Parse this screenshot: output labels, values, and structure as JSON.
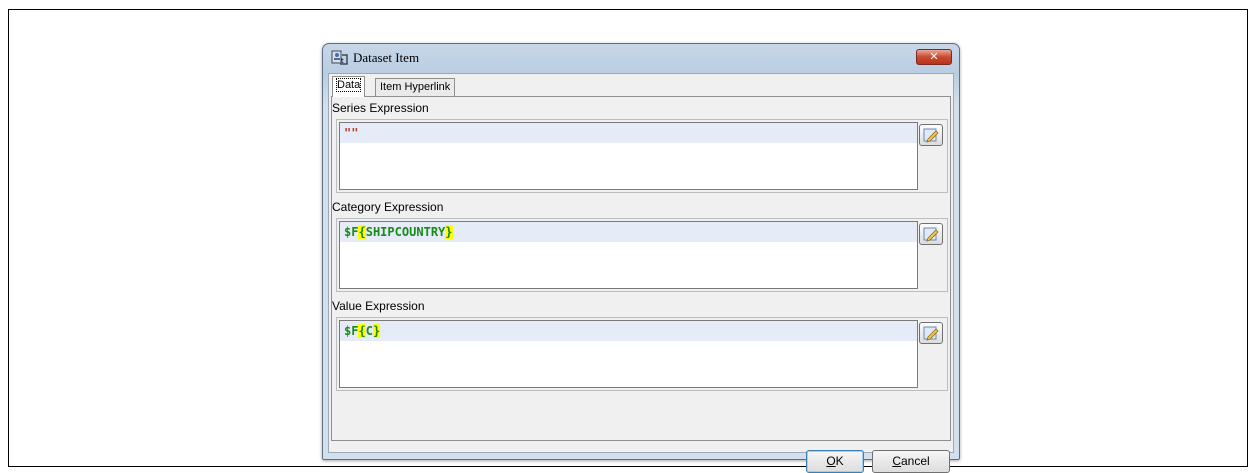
{
  "dialog": {
    "title": "Dataset Item",
    "close_label": "✕",
    "icons": {
      "app": "dataset-item-icon",
      "close": "close-icon",
      "editor": "edit-expression-icon"
    }
  },
  "tabs": [
    {
      "label": "Data",
      "active": true
    },
    {
      "label": "Item Hyperlink",
      "active": false
    }
  ],
  "sections": {
    "series": {
      "label": "Series Expression",
      "expression": "\"\""
    },
    "category": {
      "label": "Category Expression",
      "expression": "$F{SHIPCOUNTRY}"
    },
    "value": {
      "label": "Value Expression",
      "expression": "$F{C}"
    }
  },
  "buttons": {
    "ok": {
      "mnemonic": "O",
      "rest": "K"
    },
    "cancel": {
      "mnemonic": "C",
      "rest": "ancel"
    }
  },
  "colors": {
    "expression_green": "#1a8a1a",
    "string_red": "#c0392b",
    "brace_highlight": "#ffff00",
    "current_line": "#e6ecf7"
  }
}
